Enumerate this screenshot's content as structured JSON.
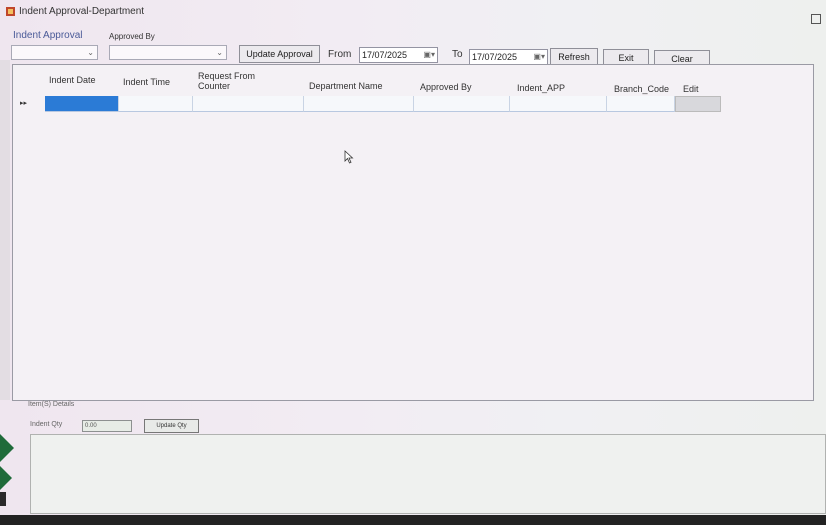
{
  "window": {
    "title": "Indent Approval-Department"
  },
  "toolbar": {
    "indent_approval_label": "Indent Approval",
    "approved_by_label": "Approved By",
    "indent_approval_value": "",
    "approved_by_value": "",
    "update_approval_label": "Update Approval",
    "from_label": "From",
    "from_date": "17/07/2025",
    "to_label": "To",
    "to_date": "17/07/2025",
    "refresh_label": "Refresh",
    "exit_label": "Exit",
    "clear_label": "Clear"
  },
  "grid": {
    "columns": [
      "Indent Date",
      "Indent Time",
      "Request From Counter",
      "Department Name",
      "Approved By",
      "Indent_APP",
      "Branch_Code",
      "Edit"
    ],
    "row_marker": "▸▸"
  },
  "details": {
    "section_label": "Item(S) Details",
    "indent_qty_label": "Indent Qty",
    "indent_qty_value": "0.00",
    "update_qty_label": "Update Qty"
  },
  "icons": {
    "app": "app-icon",
    "dropdown": "chevron-down-icon",
    "calendar": "calendar-icon",
    "cursor": "mouse-pointer-icon"
  },
  "colors": {
    "selection": "#2b7bd6",
    "label_blue": "#4a5a98"
  }
}
